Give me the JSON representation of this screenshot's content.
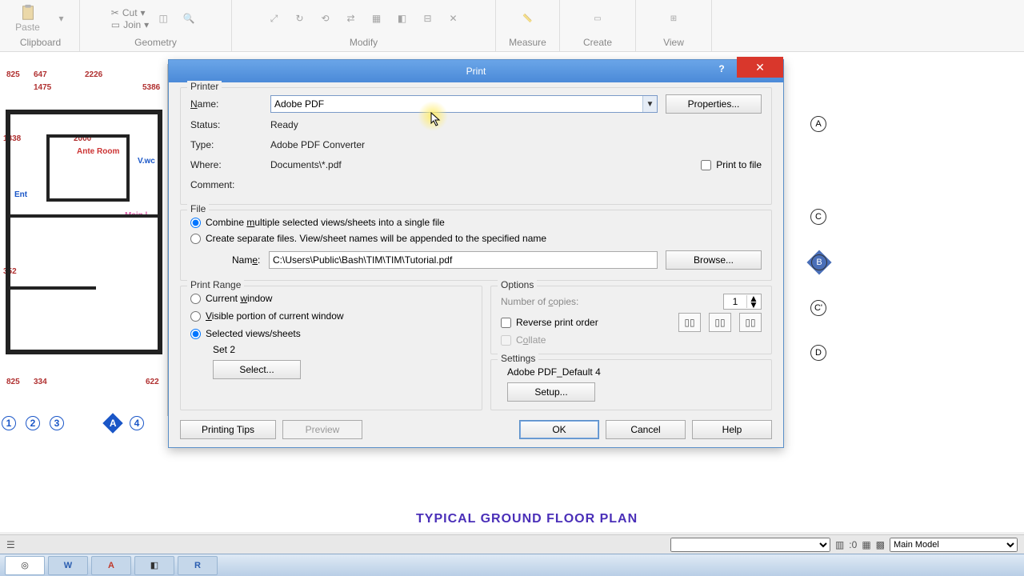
{
  "ribbon": {
    "clipboard": {
      "label": "Clipboard",
      "paste": "Paste"
    },
    "geometry": {
      "label": "Geometry",
      "cut": "Cut",
      "join": "Join"
    },
    "modify": {
      "label": "Modify"
    },
    "measure": {
      "label": "Measure"
    },
    "create": {
      "label": "Create"
    },
    "view": {
      "label": "View"
    }
  },
  "dialog": {
    "title": "Print",
    "close_glyph": "✕",
    "help_glyph": "?",
    "printer": {
      "section": "Printer",
      "name_label": "Name:",
      "name_value": "Adobe PDF",
      "properties": "Properties...",
      "status_label": "Status:",
      "status_value": "Ready",
      "type_label": "Type:",
      "type_value": "Adobe PDF Converter",
      "where_label": "Where:",
      "where_value": "Documents\\*.pdf",
      "comment_label": "Comment:",
      "print_to_file": "Print to file"
    },
    "file": {
      "section": "File",
      "combine": "Combine multiple selected views/sheets into a single file",
      "separate": "Create separate files. View/sheet names will be appended to the specified name",
      "name_label": "Name:",
      "name_value": "C:\\Users\\Public\\Bash\\TIM\\TIM\\Tutorial.pdf",
      "browse": "Browse..."
    },
    "range": {
      "section": "Print Range",
      "current": "Current window",
      "visible": "Visible portion of current window",
      "selected": "Selected views/sheets",
      "set_name": "Set 2",
      "select": "Select..."
    },
    "options": {
      "section": "Options",
      "copies_label": "Number of copies:",
      "copies_value": "1",
      "reverse": "Reverse print order",
      "collate": "Collate"
    },
    "settings": {
      "section": "Settings",
      "preset": "Adobe PDF_Default 4",
      "setup": "Setup..."
    },
    "footer": {
      "tips": "Printing Tips",
      "preview": "Preview",
      "ok": "OK",
      "cancel": "Cancel",
      "help": "Help"
    }
  },
  "canvas": {
    "title": "TYPICAL GROUND FLOOR PLAN",
    "dims": {
      "d1": "825",
      "d2": "647",
      "d3": "2226",
      "d4": "1475",
      "d5": "5386",
      "d6": "1838",
      "d7": "2000",
      "d8": "352",
      "d9": "825",
      "d10": "334",
      "d11": "622"
    },
    "rooms": {
      "ante": "Ante Room",
      "ent": "Ent",
      "main": "Main l",
      "vwc": "V.wc"
    },
    "grids": {
      "a": "A",
      "b": "B",
      "c": "C",
      "cp": "C'",
      "d": "D",
      "n1": "1",
      "n2": "2",
      "n3": "3",
      "n4": "4"
    }
  },
  "status": {
    "zoom": ":0",
    "model": "Main Model"
  }
}
